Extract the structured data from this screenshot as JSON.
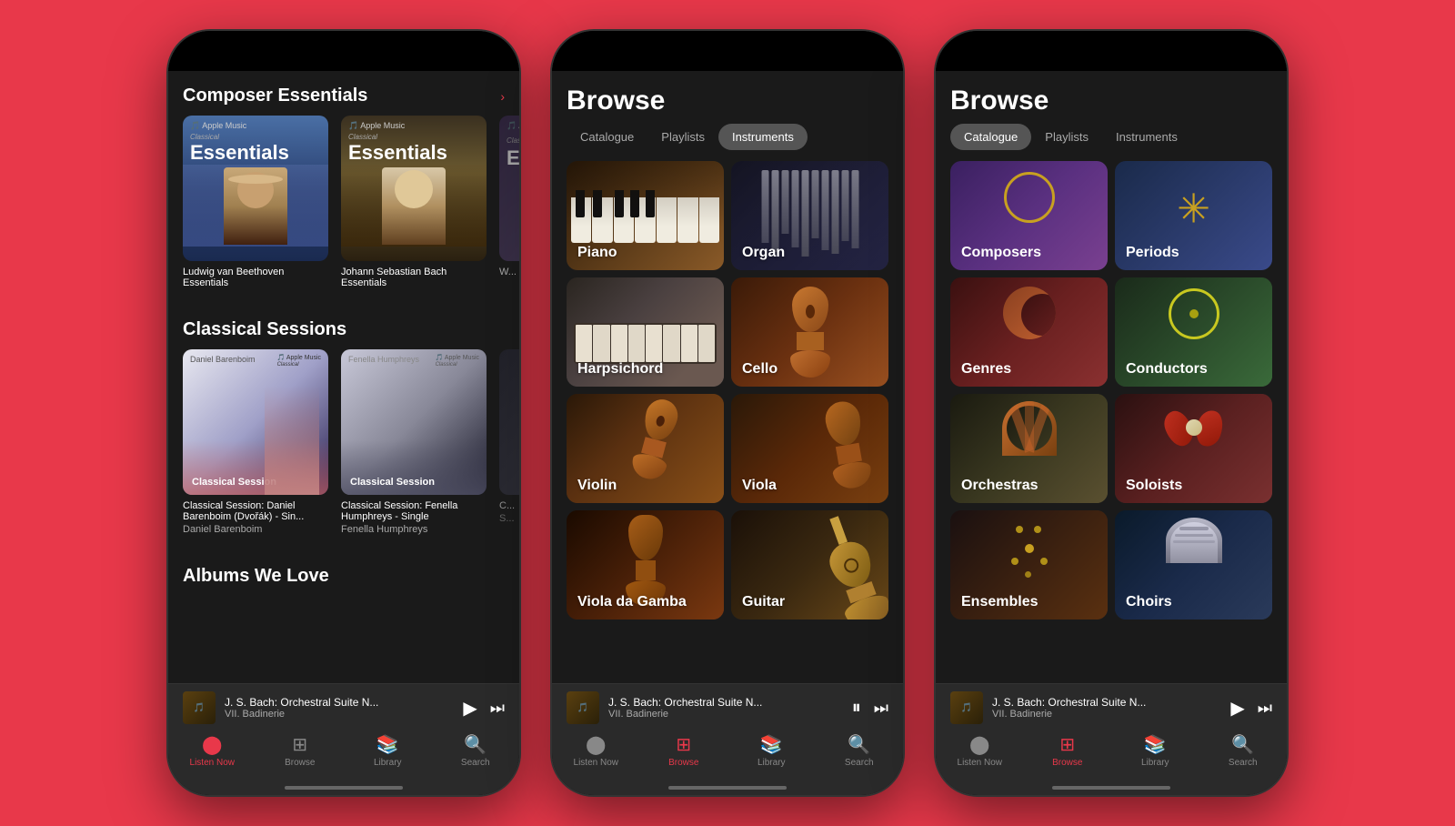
{
  "background_color": "#e8384a",
  "phones": [
    {
      "id": "phone1",
      "screen": "listen-now",
      "sections": [
        {
          "title": "Composer Essentials",
          "has_more": true,
          "more_text": ">",
          "albums": [
            {
              "id": "beethoven",
              "badge": "Apple Music Classical",
              "heading": "Essentials",
              "title": "Ludwig van Beethoven Essentials"
            },
            {
              "id": "bach",
              "badge": "Apple Music Classical",
              "heading": "Essentials",
              "title": "Johann Sebastian Bach Essentials"
            }
          ]
        },
        {
          "title": "Classical Sessions",
          "has_more": false,
          "albums": [
            {
              "id": "session1",
              "label": "Daniel Barenboim",
              "badge": "Apple Music Classical",
              "heading": "Classical Session",
              "title": "Classical Session: Daniel Barenboim (Dvořák) - Sin...",
              "artist": "Daniel Barenboim"
            },
            {
              "id": "session2",
              "label": "Fenella Humphreys",
              "badge": "Apple Music Classical",
              "heading": "Classical Session",
              "title": "Classical Session: Fenella Humphreys - Single",
              "artist": "Fenella Humphreys"
            }
          ]
        },
        {
          "title": "Albums We Love",
          "has_more": false
        }
      ],
      "player": {
        "title": "J. S. Bach: Orchestral Suite N...",
        "subtitle": "VII. Badinerie",
        "playing": false
      },
      "nav": {
        "active": "listen-now",
        "items": [
          {
            "id": "listen-now",
            "label": "Listen Now",
            "icon": "●"
          },
          {
            "id": "browse",
            "label": "Browse",
            "icon": "⊞"
          },
          {
            "id": "library",
            "label": "Library",
            "icon": "📚"
          },
          {
            "id": "search",
            "label": "Search",
            "icon": "🔍"
          }
        ]
      }
    },
    {
      "id": "phone2",
      "screen": "browse-instruments",
      "title": "Browse",
      "tabs": [
        {
          "id": "catalogue",
          "label": "Catalogue",
          "active": false
        },
        {
          "id": "playlists",
          "label": "Playlists",
          "active": false
        },
        {
          "id": "instruments",
          "label": "Instruments",
          "active": true
        }
      ],
      "instruments": [
        {
          "id": "piano",
          "label": "Piano"
        },
        {
          "id": "organ",
          "label": "Organ"
        },
        {
          "id": "harpsichord",
          "label": "Harpsichord"
        },
        {
          "id": "cello",
          "label": "Cello"
        },
        {
          "id": "violin",
          "label": "Violin"
        },
        {
          "id": "viola",
          "label": "Viola"
        },
        {
          "id": "viola-gamba",
          "label": "Viola da Gamba"
        },
        {
          "id": "guitar",
          "label": "Guitar"
        }
      ],
      "player": {
        "title": "J. S. Bach: Orchestral Suite N...",
        "subtitle": "VII. Badinerie",
        "playing": true
      },
      "nav": {
        "active": "browse",
        "items": [
          {
            "id": "listen-now",
            "label": "Listen Now",
            "icon": "●"
          },
          {
            "id": "browse",
            "label": "Browse",
            "icon": "⊞"
          },
          {
            "id": "library",
            "label": "Library",
            "icon": "📚"
          },
          {
            "id": "search",
            "label": "Search",
            "icon": "🔍"
          }
        ]
      }
    },
    {
      "id": "phone3",
      "screen": "browse-catalogue",
      "title": "Browse",
      "tabs": [
        {
          "id": "catalogue",
          "label": "Catalogue",
          "active": true
        },
        {
          "id": "playlists",
          "label": "Playlists",
          "active": false
        },
        {
          "id": "instruments",
          "label": "Instruments",
          "active": false
        }
      ],
      "categories": [
        {
          "id": "composers",
          "label": "Composers"
        },
        {
          "id": "periods",
          "label": "Periods"
        },
        {
          "id": "genres",
          "label": "Genres"
        },
        {
          "id": "conductors",
          "label": "Conductors"
        },
        {
          "id": "orchestras",
          "label": "Orchestras"
        },
        {
          "id": "soloists",
          "label": "Soloists"
        },
        {
          "id": "ensembles",
          "label": "Ensembles"
        },
        {
          "id": "choirs",
          "label": "Choirs"
        }
      ],
      "player": {
        "title": "J. S. Bach: Orchestral Suite N...",
        "subtitle": "VII. Badinerie",
        "playing": false
      },
      "nav": {
        "active": "browse",
        "items": [
          {
            "id": "listen-now",
            "label": "Listen Now",
            "icon": "●"
          },
          {
            "id": "browse",
            "label": "Browse",
            "icon": "⊞"
          },
          {
            "id": "library",
            "label": "Library",
            "icon": "📚"
          },
          {
            "id": "search",
            "label": "Search",
            "icon": "🔍"
          }
        ]
      }
    }
  ]
}
